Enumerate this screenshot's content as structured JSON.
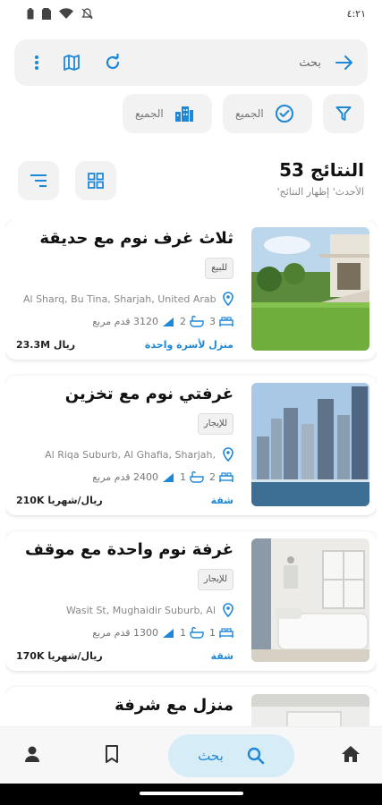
{
  "status_bar": {
    "time": "٤:٢١"
  },
  "search": {
    "placeholder": "بحث"
  },
  "filters": {
    "chip1_label": "الجميع",
    "chip2_label": "الجميع"
  },
  "results": {
    "count_label": "53 النتائج",
    "sort_label": "'الأحدث' إظهار النتائج"
  },
  "listings": [
    {
      "title": "ثلاث غرف نوم مع حديقة",
      "tag": "للبيع",
      "location": "Al Sharq, Bu Tina, Sharjah, United Arab",
      "beds": "3",
      "baths": "2",
      "area": "3120 قدم مربع",
      "type": "منزل لأسرة واحدة",
      "price": "23.3M ريال"
    },
    {
      "title": "غرفتي نوم مع تخزين",
      "tag": "للإيجار",
      "location": "Al Riqa Suburb, Al Ghafia, Sharjah,",
      "beds": "2",
      "baths": "1",
      "area": "2400 قدم مربع",
      "type": "شقة",
      "price": "210K ريال/شهريا"
    },
    {
      "title": "غرفة نوم واحدة مع موقف",
      "tag": "للإيجار",
      "location": "Wasit St, Mughaidir Suburb, Al",
      "beds": "1",
      "baths": "1",
      "area": "1300 قدم مربع",
      "type": "شقة",
      "price": "170K ريال/شهريا"
    },
    {
      "title": "منزل مع شرفة",
      "tag": "",
      "location": "",
      "beds": "",
      "baths": "",
      "area": "",
      "type": "",
      "price": ""
    }
  ],
  "bottom_nav": {
    "search_label": "بحث"
  },
  "colors": {
    "accent": "#1e88d8",
    "pill": "#d6ecf7"
  }
}
